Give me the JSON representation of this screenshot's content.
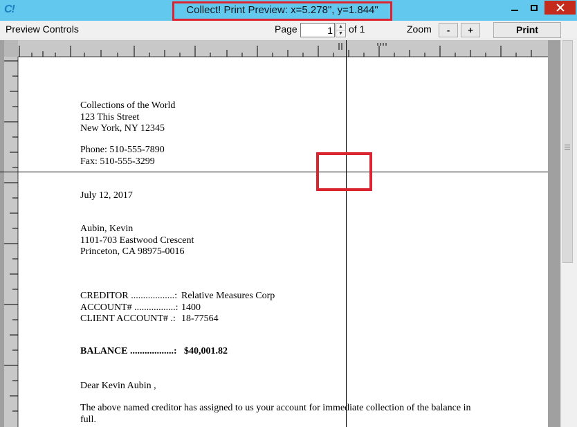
{
  "window": {
    "app_icon": "C!",
    "title": "Collect! Print Preview: x=5.278\", y=1.844\""
  },
  "toolbar": {
    "preview_controls": "Preview Controls",
    "page_label": "Page",
    "page_value": "1",
    "of_label": "of 1",
    "zoom_label": "Zoom",
    "zoom_out": "-",
    "zoom_in": "+",
    "print": "Print"
  },
  "letter": {
    "sender": {
      "name": "Collections of the World",
      "street": "123 This Street",
      "city": "New York, NY 12345",
      "phone": "Phone: 510-555-7890",
      "fax": "Fax: 510-555-3299"
    },
    "date": "July 12, 2017",
    "recipient": {
      "name": "Aubin, Kevin",
      "street": "1101-703 Eastwood Crescent",
      "city": "Princeton, CA 98975-0016"
    },
    "fields": [
      {
        "label": "CREDITOR ..................:",
        "value": "Relative Measures Corp"
      },
      {
        "label": "ACCOUNT# .................:",
        "value": "1400"
      },
      {
        "label": "CLIENT ACCOUNT# .:",
        "value": "18-77564"
      }
    ],
    "balance": {
      "label": "BALANCE ..................:",
      "value": "$40,001.82"
    },
    "greeting": "Dear Kevin Aubin ,",
    "body_line1": "The above named creditor has assigned to us your account for immediate collection of the balance in",
    "body_line2": "full."
  }
}
